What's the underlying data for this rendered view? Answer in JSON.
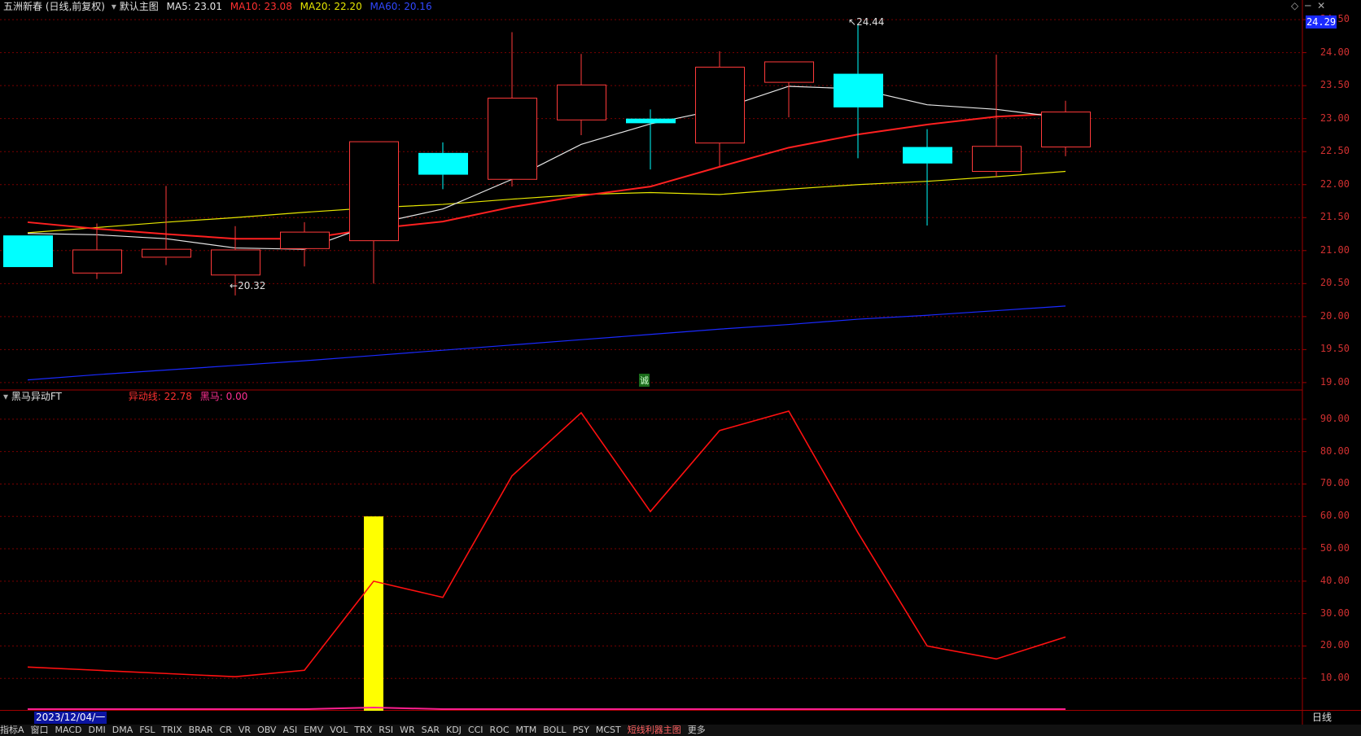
{
  "main_header": {
    "title": "五洲新春 (日线,前复权)",
    "layout": "默认主图",
    "ma5": "MA5: 23.01",
    "ma10": "MA10: 23.08",
    "ma20": "MA20: 22.20",
    "ma60": "MA60: 20.16"
  },
  "price_axis": {
    "labels": [
      "24.50",
      "24.00",
      "23.50",
      "23.00",
      "22.50",
      "22.00",
      "21.50",
      "21.00",
      "20.50",
      "20.00",
      "19.50",
      "19.00"
    ],
    "current": "24.29"
  },
  "annotations": {
    "high": "24.44",
    "low": "20.32",
    "marker": "诚"
  },
  "indicator_header": {
    "name": "黑马异动FT",
    "line1": "异动线: 22.78",
    "line2": "黑马: 0.00"
  },
  "indicator_axis": {
    "labels": [
      "90.00",
      "80.00",
      "70.00",
      "60.00",
      "50.00",
      "40.00",
      "30.00",
      "20.00",
      "10.00"
    ]
  },
  "footer": {
    "date": "2023/12/04/一",
    "period": "日线"
  },
  "tabs": [
    "指标A",
    "窗口",
    "MACD",
    "DMI",
    "DMA",
    "FSL",
    "TRIX",
    "BRAR",
    "CR",
    "VR",
    "OBV",
    "ASI",
    "EMV",
    "VOL",
    "TRX",
    "RSI",
    "WR",
    "SAR",
    "KDJ",
    "CCI",
    "ROC",
    "MTM",
    "BOLL",
    "PSY",
    "MCST",
    "短线利器主图",
    "更多"
  ],
  "colors": {
    "up": "#ff3a3a",
    "down": "#00ffff",
    "ma5": "#e6e6e6",
    "ma10": "#ff2020",
    "ma20": "#e6e600",
    "ma60": "#1a2aff",
    "grid": "#7a0000",
    "yellow_bar": "#ffff00"
  },
  "chart_data": {
    "type": "candlestick",
    "candles": [
      {
        "o": 21.23,
        "c": 20.75,
        "h": 21.23,
        "l": 20.75
      },
      {
        "o": 20.66,
        "c": 21.01,
        "h": 21.41,
        "l": 20.57
      },
      {
        "o": 20.9,
        "c": 21.02,
        "h": 21.98,
        "l": 20.78
      },
      {
        "o": 20.63,
        "c": 21.01,
        "h": 21.37,
        "l": 20.32
      },
      {
        "o": 21.03,
        "c": 21.28,
        "h": 21.43,
        "l": 20.76
      },
      {
        "o": 21.15,
        "c": 22.65,
        "h": 22.65,
        "l": 20.5
      },
      {
        "o": 22.48,
        "c": 22.15,
        "h": 22.64,
        "l": 21.93
      },
      {
        "o": 22.08,
        "c": 23.31,
        "h": 24.31,
        "l": 21.97
      },
      {
        "o": 22.98,
        "c": 23.51,
        "h": 23.98,
        "l": 22.75
      },
      {
        "o": 23.0,
        "c": 22.93,
        "h": 23.14,
        "l": 22.23
      },
      {
        "o": 22.63,
        "c": 23.78,
        "h": 24.02,
        "l": 22.28
      },
      {
        "o": 23.55,
        "c": 23.86,
        "h": 23.86,
        "l": 23.02
      },
      {
        "o": 23.68,
        "c": 23.17,
        "h": 24.44,
        "l": 22.4
      },
      {
        "o": 22.57,
        "c": 22.32,
        "h": 22.84,
        "l": 21.38
      },
      {
        "o": 22.2,
        "c": 22.58,
        "h": 23.97,
        "l": 22.12
      },
      {
        "o": 22.57,
        "c": 23.1,
        "h": 23.27,
        "l": 22.43
      }
    ],
    "ma5": [
      21.26,
      21.24,
      21.18,
      21.04,
      21.02,
      21.4,
      21.63,
      22.08,
      22.61,
      22.92,
      23.14,
      23.49,
      23.45,
      23.21,
      23.14,
      23.01
    ],
    "ma10": [
      21.43,
      21.33,
      21.25,
      21.18,
      21.18,
      21.33,
      21.44,
      21.66,
      21.83,
      21.97,
      22.27,
      22.56,
      22.76,
      22.91,
      23.03,
      23.08
    ],
    "ma20": [
      21.27,
      21.35,
      21.43,
      21.5,
      21.58,
      21.65,
      21.7,
      21.78,
      21.85,
      21.88,
      21.85,
      21.93,
      22.0,
      22.05,
      22.12,
      22.2
    ],
    "ma60": [
      19.04,
      19.12,
      19.19,
      19.26,
      19.33,
      19.41,
      19.49,
      19.57,
      19.65,
      19.73,
      19.81,
      19.88,
      19.96,
      20.02,
      20.09,
      20.16
    ],
    "ylim": [
      18.9,
      24.6
    ],
    "indicator": {
      "line": [
        13.5,
        12.5,
        11.5,
        10.5,
        12.5,
        40,
        35,
        72.5,
        92,
        61.5,
        86.5,
        92.5,
        55,
        20,
        16,
        22.78
      ],
      "bar": [
        0,
        0,
        0,
        0,
        0,
        60,
        0,
        0,
        0,
        0,
        0,
        0,
        0,
        0,
        0,
        0
      ],
      "baseline": [
        0.5,
        0.5,
        0.5,
        0.5,
        0.5,
        1.0,
        0.5,
        0.5,
        0.5,
        0.5,
        0.5,
        0.5,
        0.5,
        0.5,
        0.5,
        0.5
      ],
      "ylim": [
        0,
        95
      ]
    }
  }
}
